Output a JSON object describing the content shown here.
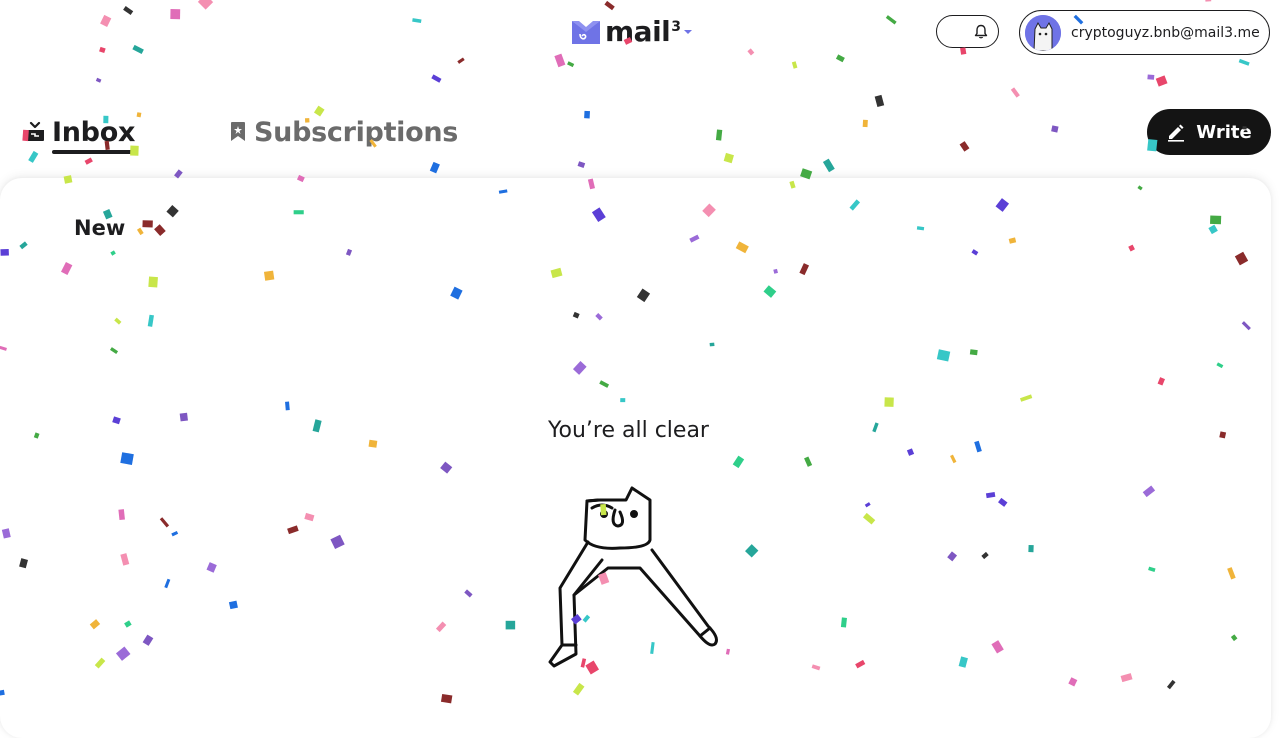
{
  "header": {
    "logo": {
      "word": "mail",
      "superscript": "3",
      "icon": "mail3-logo-icon"
    },
    "notification_icon": "bell-icon",
    "account": {
      "email": "cryptoguyz.bnb@mail3.me",
      "avatar_icon": "cat-avatar-icon"
    }
  },
  "tabs": [
    {
      "label": "Inbox",
      "icon": "inbox-icon",
      "active": true
    },
    {
      "label": "Subscriptions",
      "icon": "bookmark-icon",
      "active": false
    }
  ],
  "write_button": {
    "label": "Write",
    "icon": "pencil-icon"
  },
  "main": {
    "section_title": "New",
    "empty_state": {
      "message": "You’re all clear",
      "illustration": "dancing-cat-illustration"
    }
  },
  "colors": {
    "brand": "#6f73e6",
    "text": "#1d1d1f",
    "inactive_tab": "#6b6b6b",
    "write_button_bg": "#141414"
  },
  "decoration": "confetti"
}
